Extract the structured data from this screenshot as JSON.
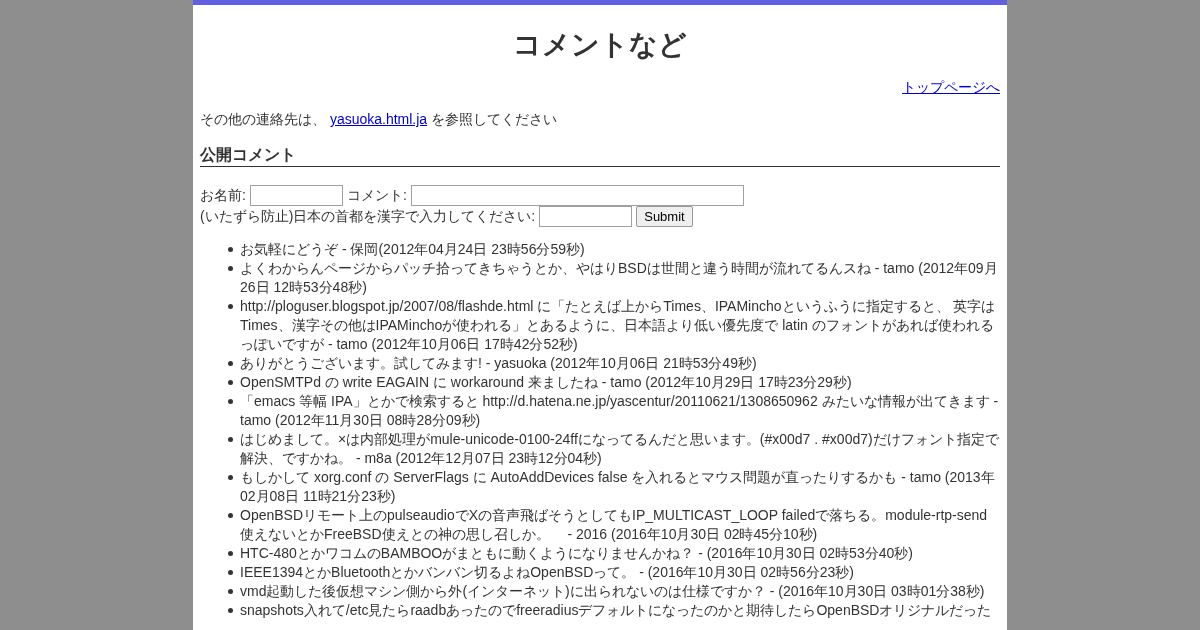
{
  "page": {
    "title": "コメントなど",
    "top_link": "トップページへ"
  },
  "contact": {
    "text_before": "その他の連絡先は、 ",
    "link": "yasuoka.html.ja",
    "text_after": " を参照してください"
  },
  "section": {
    "heading": "公開コメント"
  },
  "form": {
    "rows": [
      {
        "fields": [
          {
            "label": "お名前:",
            "kind": "short"
          },
          {
            "label": "コメント:",
            "kind": "long"
          }
        ]
      },
      {
        "fields": [
          {
            "label": "(いたずら防止)日本の首都を漢字で入力してください:",
            "kind": "short"
          }
        ],
        "submit": "Submit"
      }
    ]
  },
  "comments": [
    "お気軽にどうぞ - 保岡(2012年04月24日 23時56分59秒)",
    "よくわからんページからパッチ拾ってきちゃうとか、やはりBSDは世間と違う時間が流れてるんスね - tamo (2012年09月26日 12時53分48秒)",
    "http://ploguser.blogspot.jp/2007/08/flashde.html に「たとえば上からTimes、IPAMinchoというふうに指定すると、 英字はTimes、漢字その他はIPAMinchoが使われる」とあるように、日本語より低い優先度で latin のフォントがあれば使われるっぽいですが - tamo (2012年10月06日 17時42分52秒)",
    "ありがとうございます。試してみます! - yasuoka (2012年10月06日 21時53分49秒)",
    "OpenSMTPd の write EAGAIN に workaround 来ましたね - tamo (2012年10月29日 17時23分29秒)",
    "「emacs 等幅 IPA」とかで検索すると http://d.hatena.ne.jp/yascentur/20110621/1308650962 みたいな情報が出てきます - tamo (2012年11月30日 08時28分09秒)",
    "はじめまして。×は内部処理がmule-unicode-0100-24ffになってるんだと思います。(#x00d7 . #x00d7)だけフォント指定で解決、ですかね。 - m8a (2012年12月07日 23時12分04秒)",
    "もしかして xorg.conf の ServerFlags に AutoAddDevices false を入れるとマウス問題が直ったりするかも - tamo (2013年02月08日 11時21分23秒)",
    "OpenBSDリモート上のpulseaudioでXの音声飛ばそうとしてもIP_MULTICAST_LOOP failedで落ちる。module-rtp-send使えないとかFreeBSD使えとの神の思し召しか。　 - 2016 (2016年10月30日 02時45分10秒)",
    "HTC-480とかワコムのBAMBOOがまともに動くようになりませんかね？ - (2016年10月30日 02時53分40秒)",
    "IEEE1394とかBluetoothとかバンバン切るよねOpenBSDって。 - (2016年10月30日 02時56分23秒)",
    "vmd起動した後仮想マシン側から外(インターネット)に出られないのは仕様ですか？ - (2016年10月30日 03時01分38秒)",
    "snapshots入れて/etc見たらraadbあったのでfreeradiusデフォルトになったのかと期待したらOpenBSDオリジナルだった"
  ]
}
